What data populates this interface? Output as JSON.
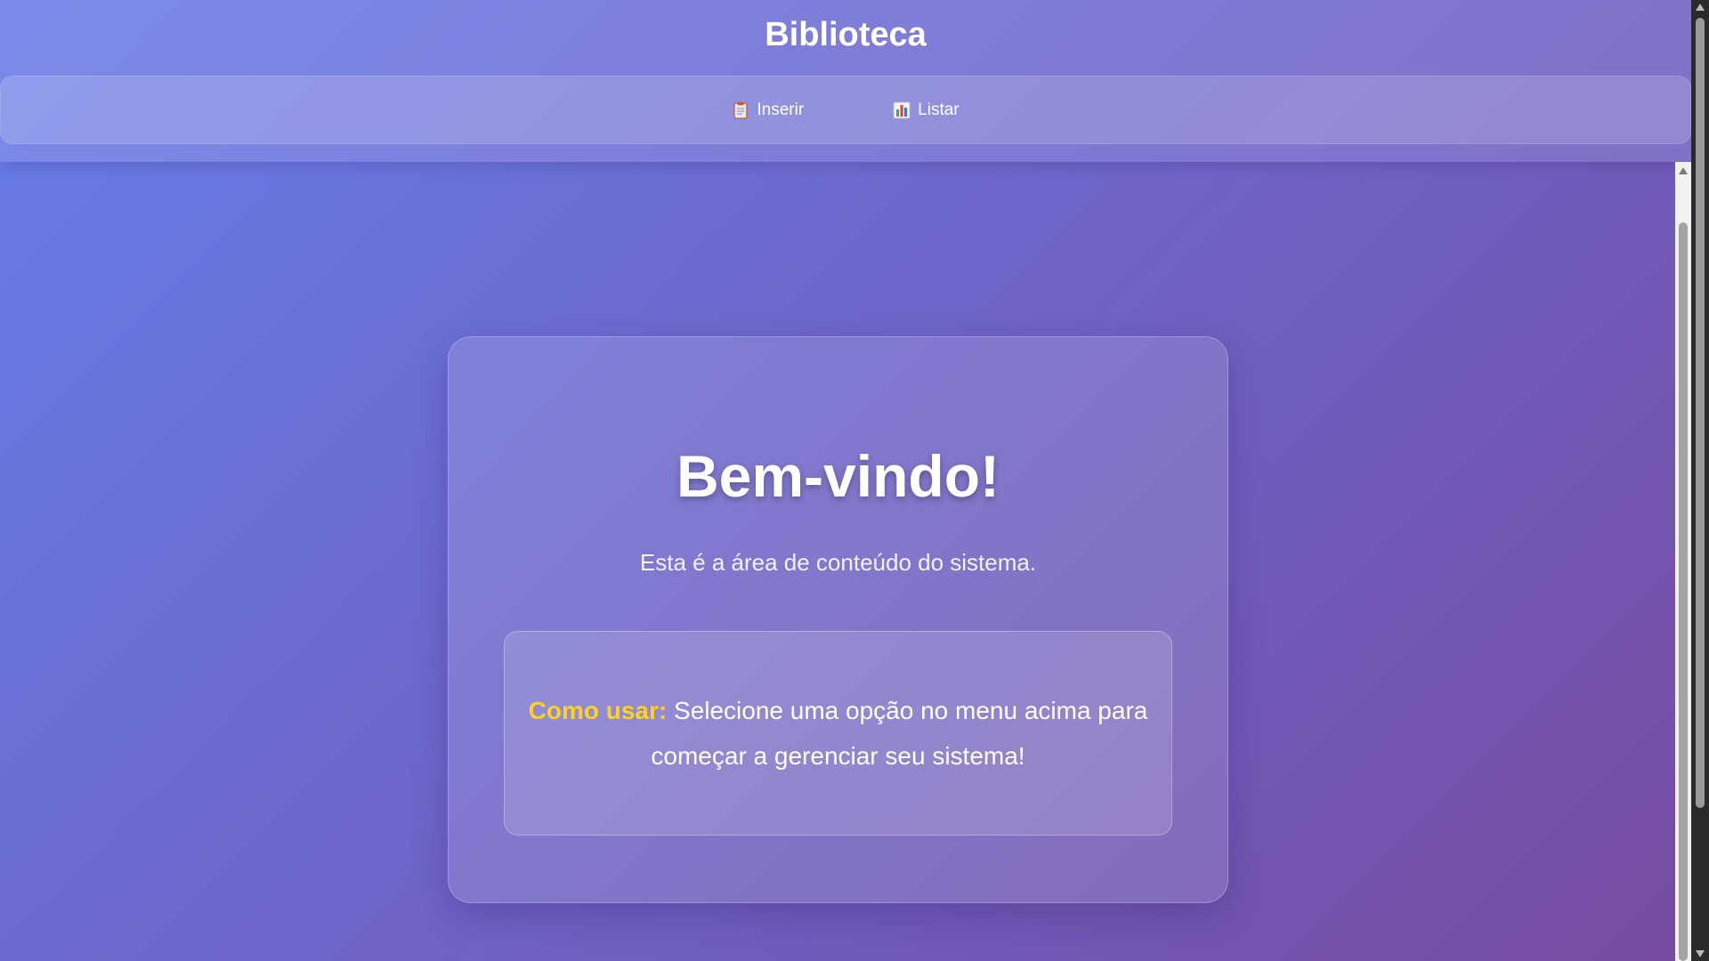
{
  "app": {
    "title": "Biblioteca"
  },
  "nav": {
    "items": [
      {
        "label": "Inserir",
        "icon": "clipboard-icon"
      },
      {
        "label": "Listar",
        "icon": "bar-chart-icon"
      }
    ]
  },
  "main": {
    "heading": "Bem-vindo!",
    "subtitle": "Esta é a área de conteúdo do sistema.",
    "tip": {
      "label": "Como usar:",
      "text": " Selecione uma opção no menu acima para começar a gerenciar seu sistema!"
    }
  },
  "colors": {
    "background_start": "#667eea",
    "background_end": "#764ba2",
    "tip_label": "#ffd21f",
    "text": "#ffffff"
  }
}
